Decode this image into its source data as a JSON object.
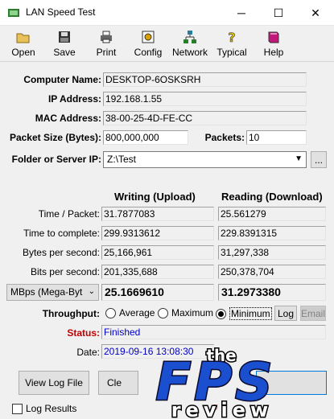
{
  "window": {
    "title": "LAN Speed Test",
    "minimize": "─",
    "maximize": "☐",
    "close": "✕"
  },
  "toolbar": {
    "open": "Open",
    "save": "Save",
    "print": "Print",
    "config": "Config",
    "network": "Network",
    "typical": "Typical",
    "help": "Help"
  },
  "info": {
    "computer_name_label": "Computer Name:",
    "computer_name": "DESKTOP-6OSKSRH",
    "ip_label": "IP Address:",
    "ip": "192.168.1.55",
    "mac_label": "MAC Address:",
    "mac": "38-00-25-4D-FE-CC",
    "packet_size_label": "Packet Size (Bytes):",
    "packet_size": "800,000,000",
    "packets_label": "Packets:",
    "packets": "10",
    "folder_label": "Folder or Server IP:",
    "folder": "Z:\\Test",
    "browse": "..."
  },
  "results": {
    "writing_header": "Writing (Upload)",
    "reading_header": "Reading (Download)",
    "rows": [
      {
        "label": "Time / Packet:",
        "write": "31.7877083",
        "read": "25.561279"
      },
      {
        "label": "Time to complete:",
        "write": "299.9313612",
        "read": "229.8391315"
      },
      {
        "label": "Bytes per second:",
        "write": "25,166,961",
        "read": "31,297,338"
      },
      {
        "label": "Bits per second:",
        "write": "201,335,688",
        "read": "250,378,704"
      }
    ],
    "unit_select": "MBps (Mega-Byt",
    "write_big": "25.1669610",
    "read_big": "31.2973380"
  },
  "throughput": {
    "label": "Throughput:",
    "average": "Average",
    "maximum": "Maximum",
    "minimum": "Minimum",
    "selected": "Minimum",
    "log": "Log",
    "email": "Email"
  },
  "status": {
    "label": "Status:",
    "value": "Finished"
  },
  "date": {
    "label": "Date:",
    "value": "2019-09-16 13:08:30"
  },
  "buttons": {
    "view_log": "View Log File",
    "clear": "Cle"
  },
  "log_results": "Log Results",
  "footer_copyright": "©",
  "watermark": {
    "line1": "the",
    "line2": "FPS",
    "line3": "review"
  },
  "colors": {
    "status_red": "#c00000",
    "link_blue": "#0000c0",
    "wm_blue": "#1a4fcf"
  }
}
